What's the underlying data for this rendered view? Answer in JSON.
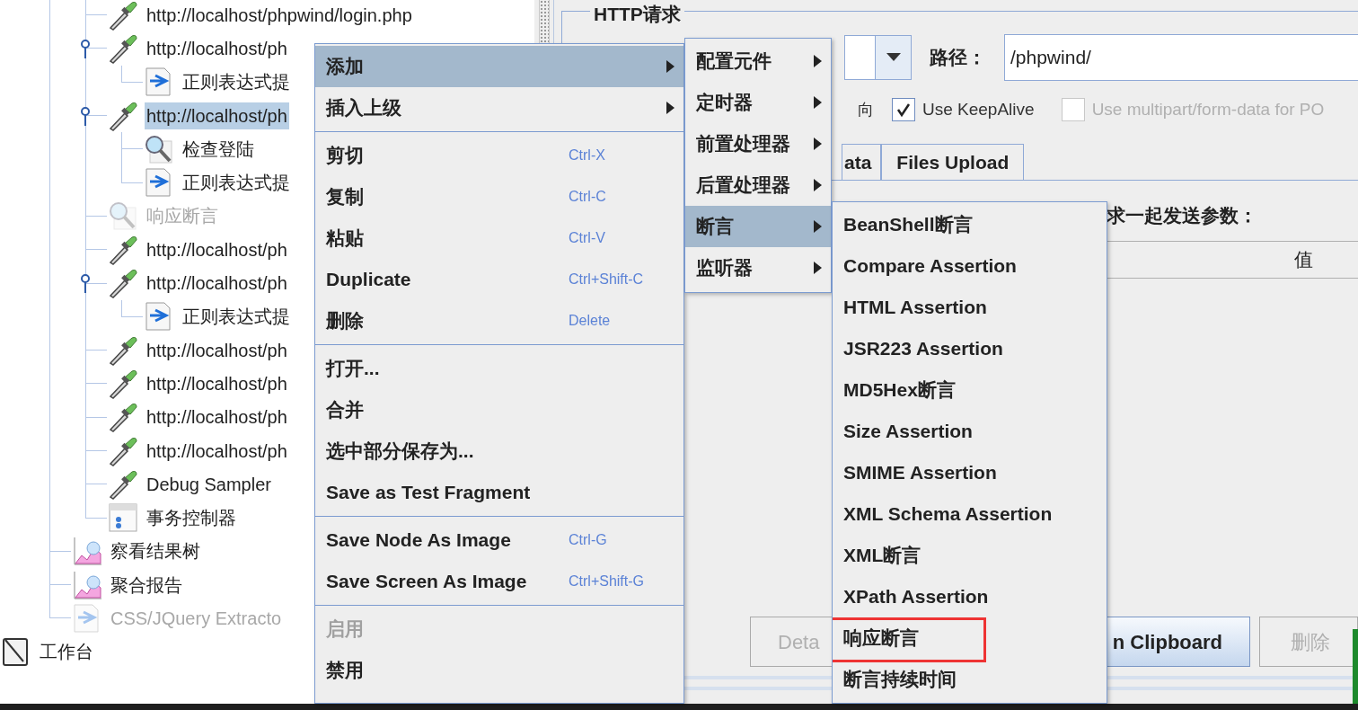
{
  "tree": [
    {
      "children": [
        {
          "children": [
            {
              "label": "http://localhost/phpwind/login.php",
              "kind": "sampler",
              "disabled": false,
              "selected": false
            },
            {
              "label": "http://localhost/ph",
              "kind": "sampler",
              "disabled": false,
              "selected": false,
              "expanded": true,
              "children": [
                {
                  "label": "正则表达式提",
                  "kind": "extractor",
                  "disabled": false,
                  "selected": false
                }
              ]
            },
            {
              "label": "http://localhost/ph",
              "kind": "sampler",
              "disabled": false,
              "selected": true,
              "expanded": true,
              "children": [
                {
                  "label": "检查登陆",
                  "kind": "assertion",
                  "disabled": false,
                  "selected": false
                },
                {
                  "label": "正则表达式提",
                  "kind": "extractor",
                  "disabled": false,
                  "selected": false
                }
              ]
            },
            {
              "label": "响应断言",
              "kind": "assertion",
              "disabled": true,
              "selected": false
            },
            {
              "label": "http://localhost/ph",
              "kind": "sampler",
              "disabled": false,
              "selected": false
            },
            {
              "label": "http://localhost/ph",
              "kind": "sampler",
              "disabled": false,
              "selected": false,
              "expanded": true,
              "children": [
                {
                  "label": "正则表达式提",
                  "kind": "extractor",
                  "disabled": false,
                  "selected": false
                }
              ]
            },
            {
              "label": "http://localhost/ph",
              "kind": "sampler",
              "disabled": false,
              "selected": false
            },
            {
              "label": "http://localhost/ph",
              "kind": "sampler",
              "disabled": false,
              "selected": false
            },
            {
              "label": "http://localhost/ph",
              "kind": "sampler",
              "disabled": false,
              "selected": false
            },
            {
              "label": "http://localhost/ph",
              "kind": "sampler",
              "disabled": false,
              "selected": false
            },
            {
              "label": "Debug Sampler",
              "kind": "sampler",
              "disabled": false,
              "selected": false
            },
            {
              "label": "事务控制器",
              "kind": "controller",
              "disabled": false,
              "selected": false
            }
          ]
        },
        {
          "label": "察看结果树",
          "kind": "listener",
          "disabled": false,
          "selected": false
        },
        {
          "label": "聚合报告",
          "kind": "listener",
          "disabled": false,
          "selected": false
        },
        {
          "label": "CSS/JQuery Extracto",
          "kind": "extractor",
          "disabled": true,
          "selected": false
        }
      ]
    },
    {
      "label": "工作台",
      "kind": "workbench",
      "disabled": false,
      "selected": false
    }
  ],
  "http_panel": {
    "title": "HTTP请求",
    "path_label": "路径：",
    "path_value": "/phpwind/",
    "redirect_fragment": "向",
    "checkboxes": [
      {
        "label": "Use KeepAlive",
        "checked": true,
        "disabled": false
      },
      {
        "label": "Use multipart/form-data for PO",
        "checked": false,
        "disabled": true
      }
    ],
    "tabs": [
      {
        "label": "ata",
        "selected": false
      },
      {
        "label": "Files Upload",
        "selected": false
      }
    ],
    "params_label": "求一起发送参数：",
    "table": {
      "columns": [
        "值"
      ]
    },
    "buttons": [
      {
        "label": "Deta",
        "disabled": true,
        "focused": false
      },
      {
        "label": "n Clipboard",
        "disabled": false,
        "focused": true
      },
      {
        "label": "删除",
        "disabled": true,
        "focused": false
      }
    ]
  },
  "context_menu": {
    "items": [
      {
        "kind": "item",
        "label": "添加",
        "submenu": true,
        "selected": true,
        "disabled": false
      },
      {
        "kind": "item",
        "label": "插入上级",
        "submenu": true,
        "selected": false,
        "disabled": false
      },
      {
        "kind": "separator"
      },
      {
        "kind": "item",
        "label": "剪切",
        "shortcut": "Ctrl-X",
        "selected": false,
        "disabled": false
      },
      {
        "kind": "item",
        "label": "复制",
        "shortcut": "Ctrl-C",
        "selected": false,
        "disabled": false
      },
      {
        "kind": "item",
        "label": "粘贴",
        "shortcut": "Ctrl-V",
        "selected": false,
        "disabled": false
      },
      {
        "kind": "item",
        "label": "Duplicate",
        "shortcut": "Ctrl+Shift-C",
        "selected": false,
        "disabled": false
      },
      {
        "kind": "item",
        "label": "删除",
        "shortcut": "Delete",
        "selected": false,
        "disabled": false
      },
      {
        "kind": "separator"
      },
      {
        "kind": "item",
        "label": "打开...",
        "selected": false,
        "disabled": false
      },
      {
        "kind": "item",
        "label": "合并",
        "selected": false,
        "disabled": false
      },
      {
        "kind": "item",
        "label": "选中部分保存为...",
        "selected": false,
        "disabled": false
      },
      {
        "kind": "item",
        "label": "Save as Test Fragment",
        "selected": false,
        "disabled": false
      },
      {
        "kind": "separator"
      },
      {
        "kind": "item",
        "label": "Save Node As Image",
        "shortcut": "Ctrl-G",
        "selected": false,
        "disabled": false
      },
      {
        "kind": "item",
        "label": "Save Screen As Image",
        "shortcut": "Ctrl+Shift-G",
        "selected": false,
        "disabled": false
      },
      {
        "kind": "separator"
      },
      {
        "kind": "item",
        "label": "启用",
        "selected": false,
        "disabled": true
      },
      {
        "kind": "item",
        "label": "禁用",
        "selected": false,
        "disabled": false
      }
    ]
  },
  "add_submenu": {
    "items": [
      {
        "label": "配置元件",
        "submenu": true,
        "selected": false
      },
      {
        "label": "定时器",
        "submenu": true,
        "selected": false
      },
      {
        "label": "前置处理器",
        "submenu": true,
        "selected": false
      },
      {
        "label": "后置处理器",
        "submenu": true,
        "selected": false
      },
      {
        "label": "断言",
        "submenu": true,
        "selected": true
      },
      {
        "label": "监听器",
        "submenu": true,
        "selected": false
      }
    ]
  },
  "assertion_submenu": {
    "items": [
      {
        "label": "BeanShell断言",
        "annotated": false
      },
      {
        "label": "Compare Assertion",
        "annotated": false
      },
      {
        "label": "HTML Assertion",
        "annotated": false
      },
      {
        "label": "JSR223 Assertion",
        "annotated": false
      },
      {
        "label": "MD5Hex断言",
        "annotated": false
      },
      {
        "label": "Size Assertion",
        "annotated": false
      },
      {
        "label": "SMIME Assertion",
        "annotated": false
      },
      {
        "label": "XML Schema Assertion",
        "annotated": false
      },
      {
        "label": "XML断言",
        "annotated": false
      },
      {
        "label": "XPath Assertion",
        "annotated": false
      },
      {
        "label": "响应断言",
        "annotated": true
      },
      {
        "label": "断言持续时间",
        "annotated": false
      }
    ]
  }
}
